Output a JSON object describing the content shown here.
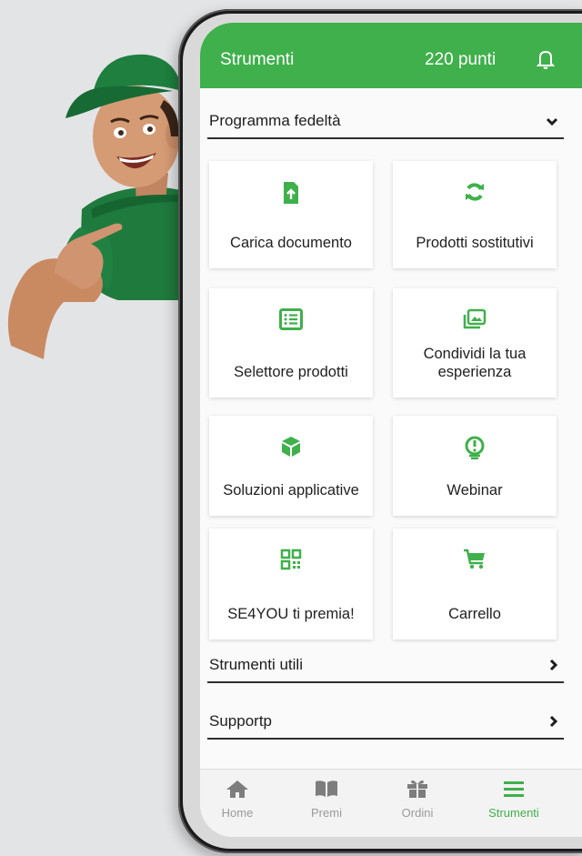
{
  "header": {
    "title": "Strumenti",
    "points": "220 punti"
  },
  "sections": {
    "loyalty": "Programma fedeltà",
    "tools": "Strumenti utili",
    "support": "Supportp"
  },
  "cards": [
    {
      "label": "Carica documento",
      "icon": "upload-file-icon"
    },
    {
      "label": "Prodotti sostitutivi",
      "icon": "refresh-icon"
    },
    {
      "label": "Selettore prodotti",
      "icon": "list-icon"
    },
    {
      "label": "Condividi la tua esperienza",
      "icon": "photo-gallery-icon"
    },
    {
      "label": "Soluzioni applicative",
      "icon": "cube-icon"
    },
    {
      "label": "Webinar",
      "icon": "webinar-icon"
    },
    {
      "label": "SE4YOU ti premia!",
      "icon": "qr-code-icon"
    },
    {
      "label": "Carrello",
      "icon": "cart-icon"
    }
  ],
  "nav": [
    {
      "label": "Home",
      "icon": "home-icon"
    },
    {
      "label": "Premi",
      "icon": "book-icon"
    },
    {
      "label": "Ordini",
      "icon": "gift-icon"
    },
    {
      "label": "Strumenti",
      "icon": "menu-icon",
      "active": true
    }
  ],
  "colors": {
    "accent": "#3fb04b",
    "background": "#e3e4e6"
  }
}
